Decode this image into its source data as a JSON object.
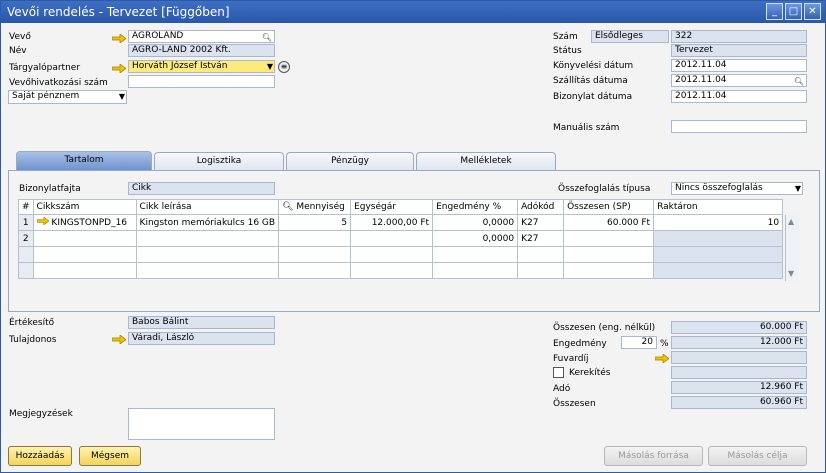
{
  "window": {
    "title": "Vevői rendelés - Tervezet [Függőben]"
  },
  "header_left": {
    "vevo_label": "Vevő",
    "vevo_value": "AGROLAND",
    "nev_label": "Név",
    "nev_value": "AGRO-LAND 2002 Kft.",
    "targyalo_label": "Tárgyalópartner",
    "targyalo_value": "Horváth József István",
    "hivatkozas_label": "Vevőhivatkozási szám",
    "hivatkozas_value": "",
    "currency_value": "Saját pénznem"
  },
  "header_right": {
    "szam_label": "Szám",
    "szam_series": "Elsődleges",
    "szam_value": "322",
    "status_label": "Státus",
    "status_value": "Tervezet",
    "konyv_label": "Könyvelési dátum",
    "konyv_value": "2012.11.04",
    "szall_label": "Szállítás dátuma",
    "szall_value": "2012.11.04",
    "bizdat_label": "Bizonylat dátuma",
    "bizdat_value": "2012.11.04",
    "manual_label": "Manuális szám",
    "manual_value": ""
  },
  "tabs": [
    {
      "label": "Tartalom"
    },
    {
      "label": "Logisztika"
    },
    {
      "label": "Pénzügy"
    },
    {
      "label": "Mellékletek"
    }
  ],
  "content": {
    "bizfajta_label": "Bizonylatfajta",
    "bizfajta_value": "Cikk",
    "osszefog_label": "Összefoglalás típusa",
    "osszefog_value": "Nincs összefoglalás"
  },
  "grid": {
    "headers": [
      "#",
      "Cikkszám",
      "Cikk leírása",
      "Mennyiség",
      "Egységár",
      "Engedmény %",
      "Adókód",
      "Összesen (SP)",
      "Raktáron"
    ],
    "rows": [
      [
        "1",
        "KINGSTONPD_16",
        "Kingston memóriakulcs 16 GB",
        "5",
        "12.000,00 Ft",
        "0,0000",
        "K27",
        "60.000 Ft",
        "10"
      ],
      [
        "2",
        "",
        "",
        "",
        "",
        "0,0000",
        "K27",
        "",
        ""
      ]
    ]
  },
  "footer_left": {
    "ertekesito_label": "Értékesítő",
    "ertekesito_value": "Babos Bálint",
    "tulajdonos_label": "Tulajdonos",
    "tulajdonos_value": "Váradi, László",
    "megjegyzes_label": "Megjegyzések",
    "megjegyzes_value": ""
  },
  "footer_right": {
    "osszesen_eng_label": "Összesen (eng. nélkül)",
    "osszesen_eng_value": "60.000 Ft",
    "engedmeny_label": "Engedmény",
    "engedmeny_pct": "20",
    "pct_sign": "%",
    "engedmeny_value": "12.000 Ft",
    "fuvardij_label": "Fuvardíj",
    "fuvardij_value": "",
    "kerekites_label": "Kerekítés",
    "kerekites_value": "",
    "ado_label": "Adó",
    "ado_value": "12.960 Ft",
    "osszesen_label": "Összesen",
    "osszesen_value": "60.960 Ft"
  },
  "buttons": {
    "add": "Hozzáadás",
    "cancel": "Mégsem",
    "copy_from": "Másolás forrása",
    "copy_to": "Másolás célja"
  },
  "colors": {
    "accent": "#2a57a8",
    "link_arrow": "#f2c200",
    "readonly": "#dbe3ee",
    "highlight": "#fde97c"
  },
  "icons": {
    "link_arrow": "arrow-right-icon",
    "search": "magnifier-icon",
    "dropdown": "chevron-down-icon"
  }
}
